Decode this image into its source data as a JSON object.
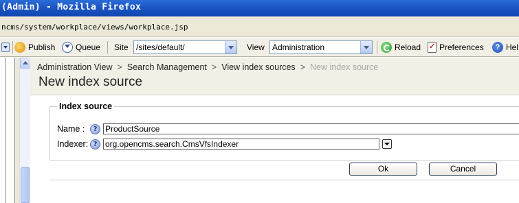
{
  "window": {
    "title": "(Admin) - Mozilla Firefox"
  },
  "address": {
    "url": "ncms/system/workplace/views/workplace.jsp"
  },
  "toolbar": {
    "publish_label": "Publish",
    "queue_label": "Queue",
    "site_label": "Site",
    "site_value": "/sites/default/",
    "view_label": "View",
    "view_value": "Administration",
    "reload_label": "Reload",
    "preferences_label": "Preferences",
    "help_label": "Hel"
  },
  "breadcrumb": {
    "items": [
      "Administration View",
      "Search Management",
      "View index sources",
      "New index source"
    ],
    "separator": ">"
  },
  "page": {
    "title": "New index source"
  },
  "form": {
    "group_label": "Index source",
    "name_label": "Name :",
    "name_value": "ProductSource",
    "indexer_label": "Indexer:",
    "indexer_value": "org.opencms.search.CmsVfsIndexer",
    "help_glyph": "?"
  },
  "buttons": {
    "ok": "Ok",
    "cancel": "Cancel"
  },
  "icons": [
    "down-arrow-icon",
    "publish-icon",
    "queue-icon",
    "reload-icon",
    "preferences-icon",
    "help-icon",
    "help-question-icon"
  ],
  "colors": {
    "titlebar": "#1c56c4",
    "chrome": "#ece9d8",
    "breadcrumb_current": "#a8a8a8"
  }
}
